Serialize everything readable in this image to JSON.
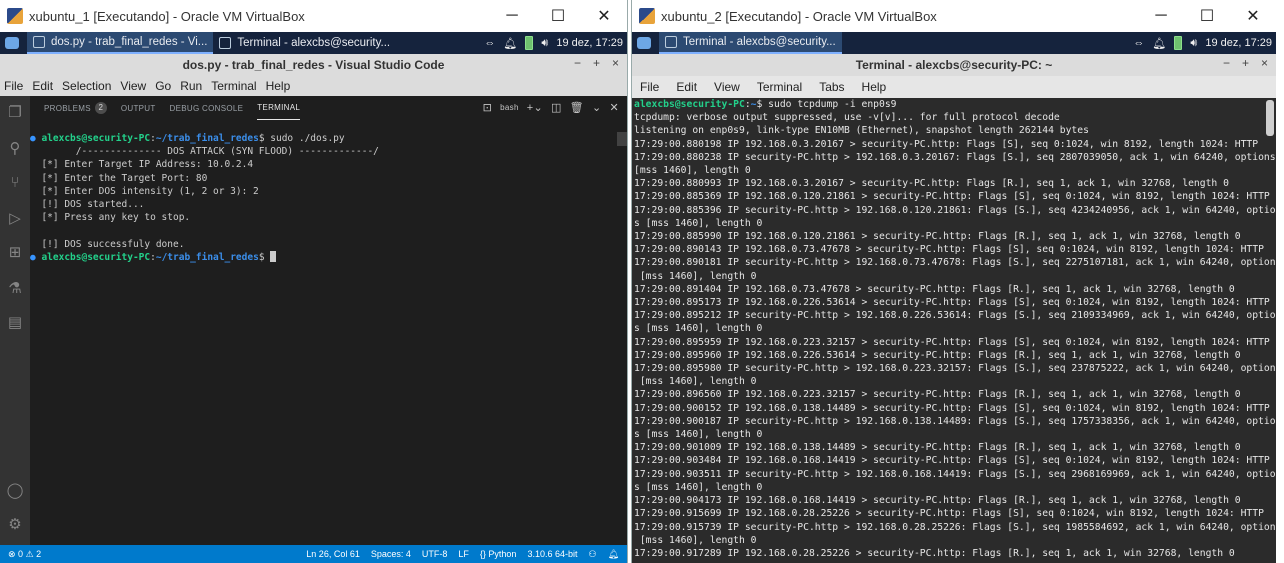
{
  "left": {
    "vbox_title": "xubuntu_1 [Executando] - Oracle VM VirtualBox",
    "taskbar": [
      {
        "label": "dos.py - trab_final_redes - Vi...",
        "active": true
      },
      {
        "label": "Terminal - alexcbs@security...",
        "active": false
      }
    ],
    "tray_arrows": "⇔",
    "clock": "19 dez, 17:29",
    "vscode_title": "dos.py - trab_final_redes - Visual Studio Code",
    "menu": [
      "File",
      "Edit",
      "Selection",
      "View",
      "Go",
      "Run",
      "Terminal",
      "Help"
    ],
    "panel_tabs": {
      "problems": "PROBLEMS",
      "problems_count": "2",
      "output": "OUTPUT",
      "debug": "DEBUG CONSOLE",
      "terminal": "TERMINAL"
    },
    "shell": "bash",
    "terminal": {
      "prompt_user": "alexcbs@security-PC",
      "prompt_path": "~/trab_final_redes",
      "command": "$ sudo ./dos.py",
      "lines": [
        "        /-------------- DOS ATTACK (SYN FLOOD) -------------/",
        "  [*] Enter Target IP Address: 10.0.2.4",
        "  [*] Enter the Target Port: 80",
        "  [*] Enter DOS intensity (1, 2 or 3): 2",
        "  [!] DOS started...",
        "  [*] Press any key to stop.",
        "",
        "  [!] DOS successfuly done."
      ]
    },
    "status": {
      "errors": "0",
      "warnings": "2",
      "position": "Ln 26, Col 61",
      "spaces": "Spaces: 4",
      "encoding": "UTF-8",
      "eol": "LF",
      "language": "Python",
      "interpreter": "3.10.6 64-bit"
    }
  },
  "right": {
    "vbox_title": "xubuntu_2 [Executando] - Oracle VM VirtualBox",
    "taskbar": [
      {
        "label": "Terminal - alexcbs@security...",
        "active": true
      }
    ],
    "tray_arrows": "⇔",
    "clock": "19 dez, 17:29",
    "terminal_title": "Terminal - alexcbs@security-PC: ~",
    "menu": [
      "File",
      "Edit",
      "View",
      "Terminal",
      "Tabs",
      "Help"
    ],
    "prompt_user": "alexcbs@security-PC",
    "prompt_path": "~",
    "command": "$ sudo tcpdump -i enp0s9",
    "output": [
      "tcpdump: verbose output suppressed, use -v[v]... for full protocol decode",
      "listening on enp0s9, link-type EN10MB (Ethernet), snapshot length 262144 bytes",
      "17:29:00.880198 IP 192.168.0.3.20167 > security-PC.http: Flags [S], seq 0:1024, win 8192, length 1024: HTTP",
      "17:29:00.880238 IP security-PC.http > 192.168.0.3.20167: Flags [S.], seq 2807039050, ack 1, win 64240, options",
      "[mss 1460], length 0",
      "17:29:00.880993 IP 192.168.0.3.20167 > security-PC.http: Flags [R.], seq 1, ack 1, win 32768, length 0",
      "17:29:00.885369 IP 192.168.0.120.21861 > security-PC.http: Flags [S], seq 0:1024, win 8192, length 1024: HTTP",
      "17:29:00.885396 IP security-PC.http > 192.168.0.120.21861: Flags [S.], seq 4234240956, ack 1, win 64240, option",
      "s [mss 1460], length 0",
      "17:29:00.885990 IP 192.168.0.120.21861 > security-PC.http: Flags [R.], seq 1, ack 1, win 32768, length 0",
      "17:29:00.890143 IP 192.168.0.73.47678 > security-PC.http: Flags [S], seq 0:1024, win 8192, length 1024: HTTP",
      "17:29:00.890181 IP security-PC.http > 192.168.0.73.47678: Flags [S.], seq 2275107181, ack 1, win 64240, options",
      " [mss 1460], length 0",
      "17:29:00.891404 IP 192.168.0.73.47678 > security-PC.http: Flags [R.], seq 1, ack 1, win 32768, length 0",
      "17:29:00.895173 IP 192.168.0.226.53614 > security-PC.http: Flags [S], seq 0:1024, win 8192, length 1024: HTTP",
      "17:29:00.895212 IP security-PC.http > 192.168.0.226.53614: Flags [S.], seq 2109334969, ack 1, win 64240, option",
      "s [mss 1460], length 0",
      "17:29:00.895959 IP 192.168.0.223.32157 > security-PC.http: Flags [S], seq 0:1024, win 8192, length 1024: HTTP",
      "17:29:00.895960 IP 192.168.0.226.53614 > security-PC.http: Flags [R.], seq 1, ack 1, win 32768, length 0",
      "17:29:00.895980 IP security-PC.http > 192.168.0.223.32157: Flags [S.], seq 237875222, ack 1, win 64240, options",
      " [mss 1460], length 0",
      "17:29:00.896560 IP 192.168.0.223.32157 > security-PC.http: Flags [R.], seq 1, ack 1, win 32768, length 0",
      "17:29:00.900152 IP 192.168.0.138.14489 > security-PC.http: Flags [S], seq 0:1024, win 8192, length 1024: HTTP",
      "17:29:00.900187 IP security-PC.http > 192.168.0.138.14489: Flags [S.], seq 1757338356, ack 1, win 64240, option",
      "s [mss 1460], length 0",
      "17:29:00.901009 IP 192.168.0.138.14489 > security-PC.http: Flags [R.], seq 1, ack 1, win 32768, length 0",
      "17:29:00.903484 IP 192.168.0.168.14419 > security-PC.http: Flags [S], seq 0:1024, win 8192, length 1024: HTTP",
      "17:29:00.903511 IP security-PC.http > 192.168.0.168.14419: Flags [S.], seq 2968169969, ack 1, win 64240, option",
      "s [mss 1460], length 0",
      "17:29:00.904173 IP 192.168.0.168.14419 > security-PC.http: Flags [R.], seq 1, ack 1, win 32768, length 0",
      "17:29:00.915699 IP 192.168.0.28.25226 > security-PC.http: Flags [S], seq 0:1024, win 8192, length 1024: HTTP",
      "17:29:00.915739 IP security-PC.http > 192.168.0.28.25226: Flags [S.], seq 1985584692, ack 1, win 64240, options",
      " [mss 1460], length 0",
      "17:29:00.917289 IP 192.168.0.28.25226 > security-PC.http: Flags [R.], seq 1, ack 1, win 32768, length 0"
    ]
  }
}
